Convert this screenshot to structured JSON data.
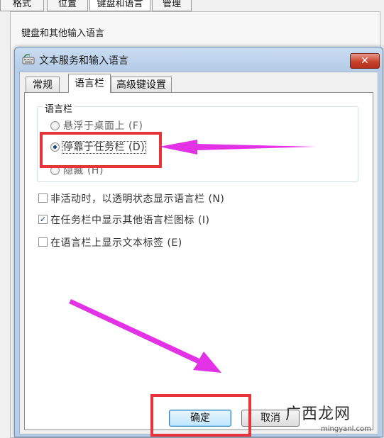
{
  "background_window": {
    "tabs": [
      "格式",
      "位置",
      "键盘和语言",
      "管理"
    ],
    "group_label": "键盘和其他输入语言"
  },
  "dialog": {
    "title": "文本服务和输入语言",
    "close_label": "✕",
    "tabs": [
      "常规",
      "语言栏",
      "高级键设置"
    ],
    "active_tab": "语言栏",
    "language_bar_group": {
      "label": "语言栏",
      "options": [
        {
          "label": "悬浮于桌面上 (F)",
          "checked": false
        },
        {
          "label": "停靠于任务栏 (D)",
          "checked": true
        },
        {
          "label": "隐藏 (H)",
          "checked": false
        }
      ]
    },
    "checkboxes": [
      {
        "label": "非活动时，以透明状态显示语言栏 (N)",
        "checked": false
      },
      {
        "label": "在任务栏中显示其他语言栏图标 (I)",
        "checked": true
      },
      {
        "label": "在语言栏上显示文本标签 (E)",
        "checked": false
      }
    ],
    "buttons": {
      "ok": "确定",
      "cancel": "取消"
    }
  },
  "annotation_colors": {
    "arrow": "#e331e6",
    "box": "#e8333b"
  },
  "watermark": {
    "logo": "广西龙网",
    "site": "mingyanl.com"
  }
}
